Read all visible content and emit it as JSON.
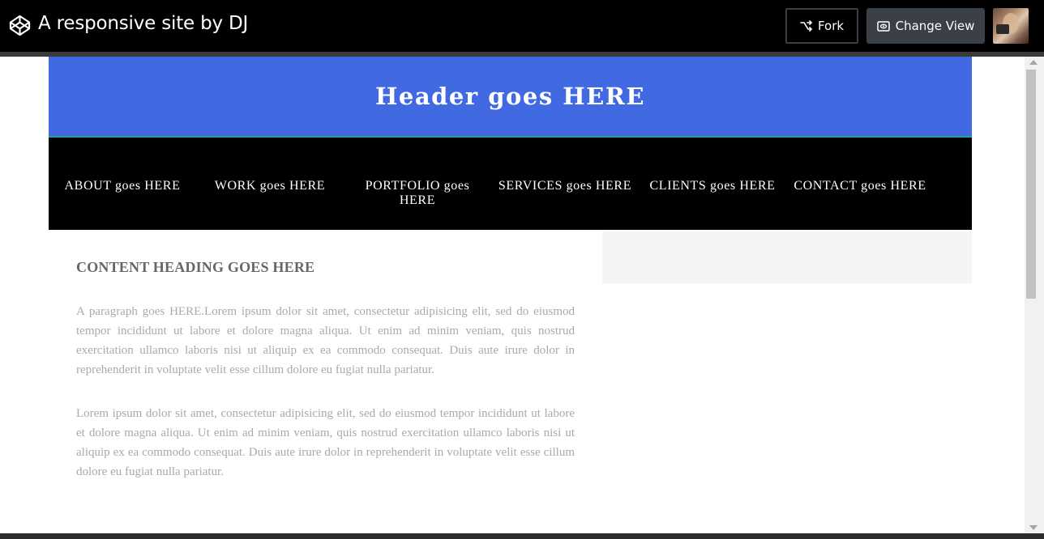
{
  "app": {
    "title": "A responsive site by DJ",
    "fork_label": "Fork",
    "change_view_label": "Change View"
  },
  "site": {
    "header": "Header goes HERE",
    "nav": [
      "ABOUT goes HERE",
      "WORK goes HERE",
      "PORTFOLIO goes HERE",
      "SERVICES goes HERE",
      "CLIENTS goes HERE",
      "CONTACT goes HERE"
    ],
    "content": {
      "heading": "CONTENT HEADING GOES HERE",
      "paragraphs": [
        "A paragraph goes HERE.Lorem ipsum dolor sit amet, consectetur adipisicing elit, sed do eiusmod tempor incididunt ut labore et dolore magna aliqua. Ut enim ad minim veniam, quis nostrud exercitation ullamco laboris nisi ut aliquip ex ea commodo consequat. Duis aute irure dolor in reprehenderit in voluptate velit esse cillum dolore eu fugiat nulla pariatur.",
        "Lorem ipsum dolor sit amet, consectetur adipisicing elit, sed do eiusmod tempor incididunt ut labore et dolore magna aliqua. Ut enim ad minim veniam, quis nostrud exercitation ullamco laboris nisi ut aliquip ex ea commodo consequat. Duis aute irure dolor in reprehenderit in voluptate velit esse cillum dolore eu fugiat nulla pariatur."
      ]
    }
  },
  "colors": {
    "header_bg": "#4169e1",
    "nav_bg": "#000000",
    "topbar_bg": "#000000",
    "change_view_bg": "#3b3f47"
  },
  "icons": {
    "logo": "codepen-cube-icon",
    "fork": "fork-icon",
    "change_view": "eye-icon"
  }
}
